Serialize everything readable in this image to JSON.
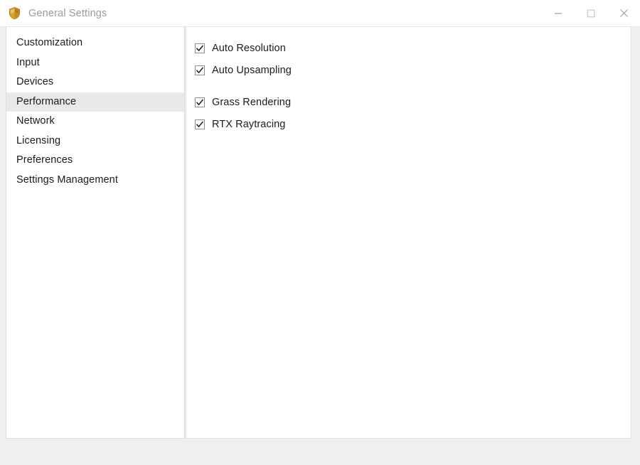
{
  "window": {
    "title": "General Settings",
    "app_icon": "shield-icon",
    "accent_color": "#d19b2a",
    "title_color": "#9b9b9b",
    "selected_row_color": "#e9e9e9",
    "footer_color": "#efefef"
  },
  "titlebar": {
    "minimize_label": "Minimize",
    "maximize_label": "Maximize",
    "close_label": "Close"
  },
  "sidebar": {
    "items": [
      {
        "label": "Customization",
        "selected": false
      },
      {
        "label": "Input",
        "selected": false
      },
      {
        "label": "Devices",
        "selected": false
      },
      {
        "label": "Performance",
        "selected": true
      },
      {
        "label": "Network",
        "selected": false
      },
      {
        "label": "Licensing",
        "selected": false
      },
      {
        "label": "Preferences",
        "selected": false
      },
      {
        "label": "Settings Management",
        "selected": false
      }
    ]
  },
  "content": {
    "groups": [
      {
        "options": [
          {
            "label": "Auto Resolution",
            "checked": true
          },
          {
            "label": "Auto Upsampling",
            "checked": true
          }
        ]
      },
      {
        "options": [
          {
            "label": "Grass Rendering",
            "checked": true
          },
          {
            "label": "RTX Raytracing",
            "checked": true
          }
        ]
      }
    ]
  }
}
